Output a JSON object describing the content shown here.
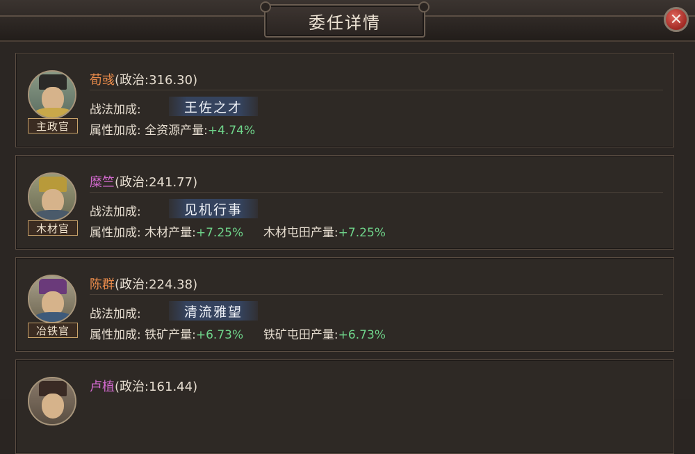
{
  "title": "委任详情",
  "close_label": "✕",
  "colors": {
    "name_orange": "#e88a4a",
    "name_purple": "#d46ad0",
    "bonus_green": "#6fd48a"
  },
  "officers": [
    {
      "name": "荀彧",
      "politics": "(政治:316.30)",
      "name_color": "orange",
      "role": "主政官",
      "skill_label": "战法加成:",
      "skill": "王佐之才",
      "attr_label": "属性加成:",
      "bonuses": [
        {
          "label": "全资源产量:",
          "value": "+4.74%"
        }
      ]
    },
    {
      "name": "糜竺",
      "politics": "(政治:241.77)",
      "name_color": "purple",
      "role": "木材官",
      "skill_label": "战法加成:",
      "skill": "见机行事",
      "attr_label": "属性加成:",
      "bonuses": [
        {
          "label": "木材产量:",
          "value": "+7.25%"
        },
        {
          "label": "木材屯田产量:",
          "value": "+7.25%"
        }
      ]
    },
    {
      "name": "陈群",
      "politics": "(政治:224.38)",
      "name_color": "orange",
      "role": "冶铁官",
      "skill_label": "战法加成:",
      "skill": "清流雅望",
      "attr_label": "属性加成:",
      "bonuses": [
        {
          "label": "铁矿产量:",
          "value": "+6.73%"
        },
        {
          "label": "铁矿屯田产量:",
          "value": "+6.73%"
        }
      ]
    },
    {
      "name": "卢植",
      "politics": "(政治:161.44)",
      "name_color": "purple"
    }
  ]
}
